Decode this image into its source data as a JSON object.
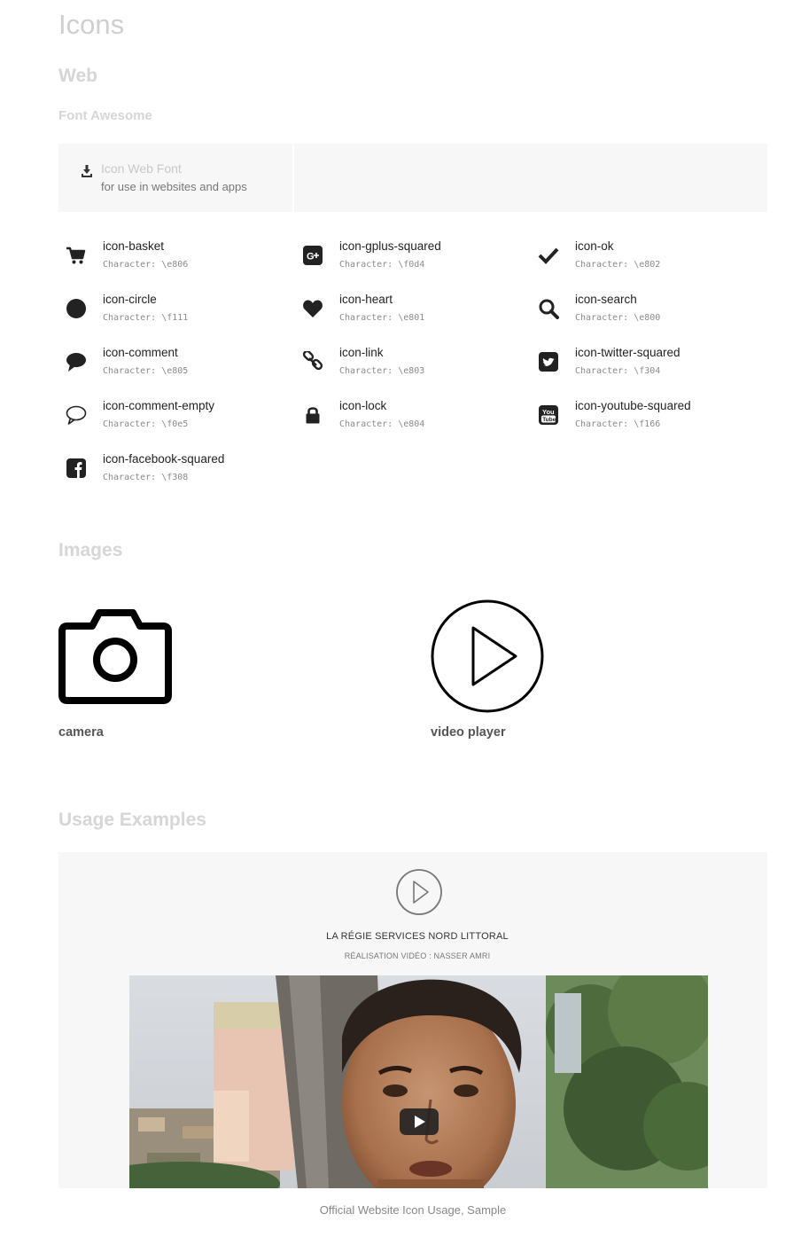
{
  "page_title": "Icons",
  "section_web": "Web",
  "subsection_font": "Font Awesome",
  "download": {
    "title": "Icon Web Font",
    "subtitle": "for use in websites and apps",
    "icon": "download-icon"
  },
  "icons": [
    {
      "name": "icon-basket",
      "code": "Character: \\e806",
      "icon": "basket-icon"
    },
    {
      "name": "icon-gplus-squared",
      "code": "Character: \\f0d4",
      "icon": "gplus-squared-icon"
    },
    {
      "name": "icon-ok",
      "code": "Character: \\e802",
      "icon": "ok-icon"
    },
    {
      "name": "icon-circle",
      "code": "Character: \\f111",
      "icon": "circle-icon"
    },
    {
      "name": "icon-heart",
      "code": "Character: \\e801",
      "icon": "heart-icon"
    },
    {
      "name": "icon-search",
      "code": "Character: \\e800",
      "icon": "search-icon"
    },
    {
      "name": "icon-comment",
      "code": "Character: \\e805",
      "icon": "comment-icon"
    },
    {
      "name": "icon-link",
      "code": "Character: \\e803",
      "icon": "link-icon"
    },
    {
      "name": "icon-twitter-squared",
      "code": "Character: \\f304",
      "icon": "twitter-squared-icon"
    },
    {
      "name": "icon-comment-empty",
      "code": "Character: \\f0e5",
      "icon": "comment-empty-icon"
    },
    {
      "name": "icon-lock",
      "code": "Character: \\e804",
      "icon": "lock-icon"
    },
    {
      "name": "icon-youtube-squared",
      "code": "Character: \\f166",
      "icon": "youtube-squared-icon"
    },
    {
      "name": "icon-facebook-squared",
      "code": "Character: \\f308",
      "icon": "facebook-squared-icon"
    }
  ],
  "section_images": "Images",
  "images": [
    {
      "caption": "camera",
      "icon": "camera-icon"
    },
    {
      "caption": "video player",
      "icon": "video-player-icon"
    }
  ],
  "section_usage": "Usage Examples",
  "usage": {
    "title": "LA RÉGIE SERVICES NORD LITTORAL",
    "subtitle": "RÉALISATION VIDÉO : NASSER AMRI",
    "caption": "Official Website Icon Usage, Sample"
  }
}
